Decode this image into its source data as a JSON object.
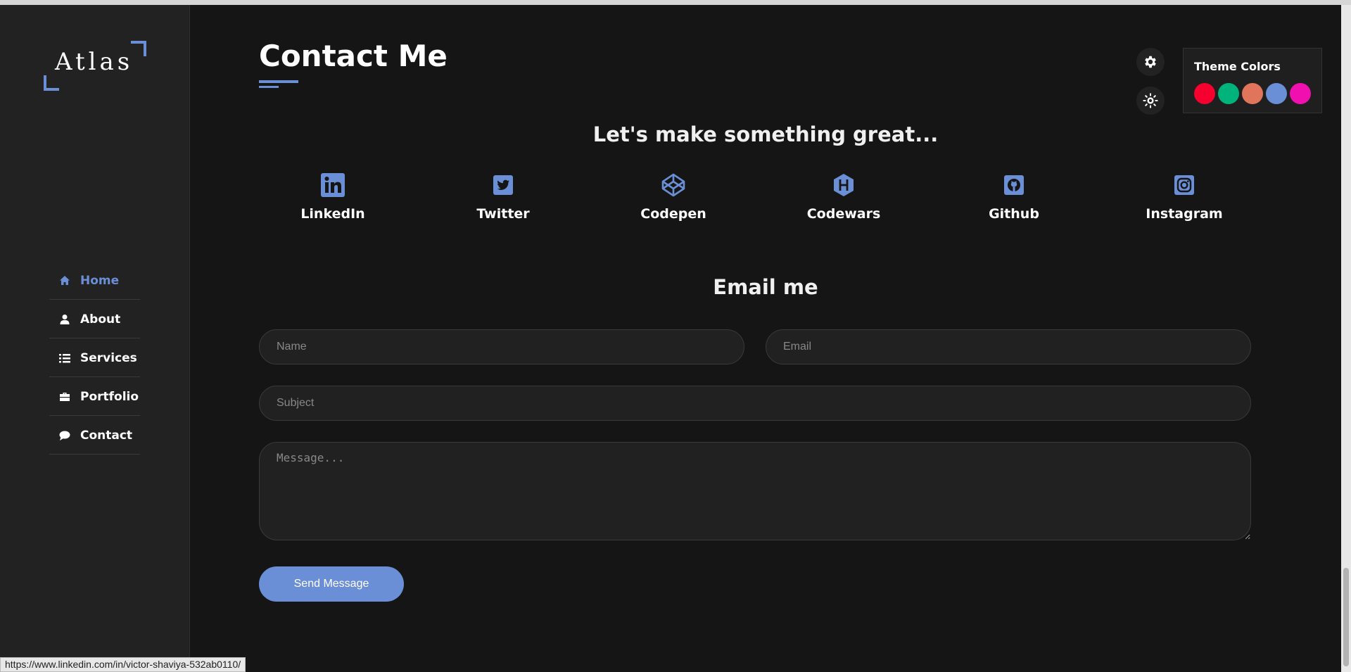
{
  "logo": {
    "text": "Atlas"
  },
  "nav": {
    "items": [
      {
        "label": "Home",
        "icon": "home-icon",
        "active": true
      },
      {
        "label": "About",
        "icon": "user-icon"
      },
      {
        "label": "Services",
        "icon": "list-icon"
      },
      {
        "label": "Portfolio",
        "icon": "briefcase-icon"
      },
      {
        "label": "Contact",
        "icon": "comment-icon"
      }
    ]
  },
  "page": {
    "title": "Contact Me",
    "tagline": "Let's make something great...",
    "email_heading": "Email me"
  },
  "socials": [
    {
      "label": "LinkedIn",
      "icon": "linkedin-icon"
    },
    {
      "label": "Twitter",
      "icon": "twitter-icon"
    },
    {
      "label": "Codepen",
      "icon": "codepen-icon"
    },
    {
      "label": "Codewars",
      "icon": "codewars-icon"
    },
    {
      "label": "Github",
      "icon": "github-icon"
    },
    {
      "label": "Instagram",
      "icon": "instagram-icon"
    }
  ],
  "form": {
    "name_placeholder": "Name",
    "email_placeholder": "Email",
    "subject_placeholder": "Subject",
    "message_placeholder": "Message...",
    "send_label": "Send Message"
  },
  "theme_panel": {
    "title": "Theme Colors",
    "colors": [
      "#f5002f",
      "#00b37a",
      "#e0755b",
      "#6b8fd6",
      "#f010b0"
    ]
  },
  "controls": {
    "settings_icon": "gear-icon",
    "mode_icon": "sun-icon"
  },
  "status_bar": {
    "url": "https://www.linkedin.com/in/victor-shaviya-532ab0110/"
  },
  "accent_color": "#6b8fd6"
}
